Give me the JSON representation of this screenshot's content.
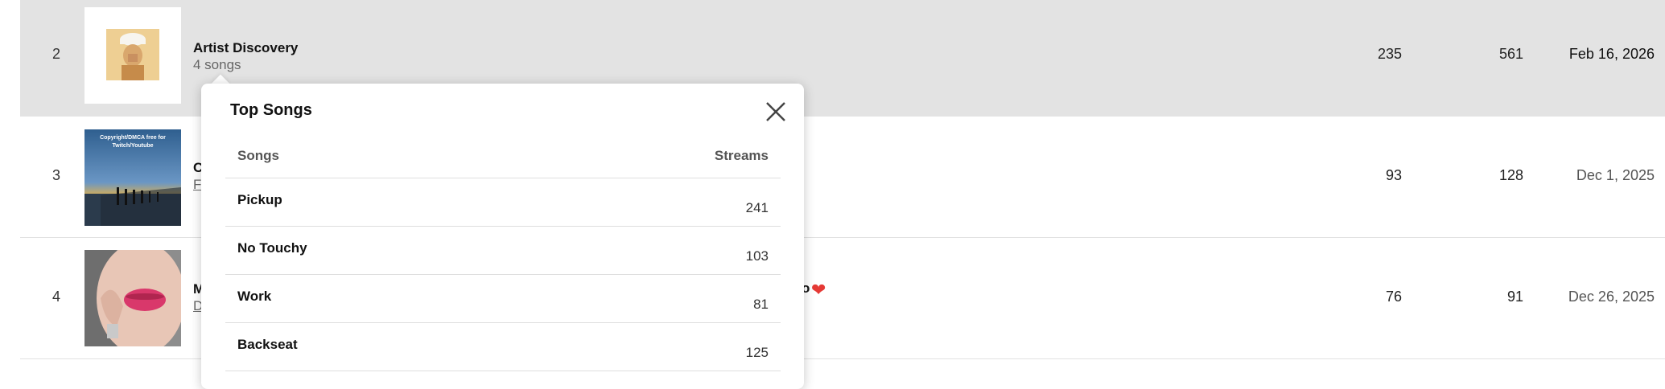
{
  "rows": [
    {
      "rank": "2",
      "title": "Artist Discovery",
      "subtitle": "4 songs",
      "stat_a": "235",
      "stat_b": "561",
      "date": "Feb 16, 2026",
      "thumb_icon": "person-in-white-cap-photo"
    },
    {
      "rank": "3",
      "title": "C",
      "subtitle": "F",
      "stat_a": "93",
      "stat_b": "128",
      "date": "Dec 1, 2025",
      "thumb_icon": "pier-sunset-photo",
      "thumb_caption": "Copyright/DMCA free for Twitch/Youtube"
    },
    {
      "rank": "4",
      "title": "M",
      "subtitle": "D",
      "title_tail": "o",
      "stat_a": "76",
      "stat_b": "91",
      "date": "Dec 26, 2025",
      "thumb_icon": "lips-portrait-photo"
    }
  ],
  "popover": {
    "title": "Top Songs",
    "close_icon": "close-icon",
    "columns": {
      "songs": "Songs",
      "streams": "Streams"
    },
    "songs": [
      {
        "name": "Pickup",
        "streams": "241"
      },
      {
        "name": "No Touchy",
        "streams": "103"
      },
      {
        "name": "Work",
        "streams": "81"
      },
      {
        "name": "Backseat",
        "streams": "125"
      }
    ]
  },
  "colors": {
    "highlight_row": "#e3e3e3",
    "heart": "#e53935"
  }
}
